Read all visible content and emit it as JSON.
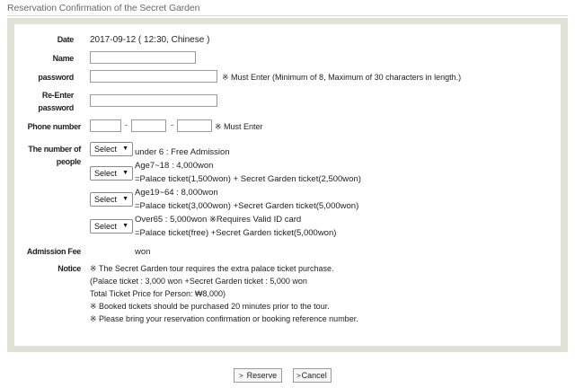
{
  "title": "Reservation Confirmation of the Secret Garden",
  "form": {
    "date_label": "Date",
    "date_value": "2017-09-12 ( 12:30, Chinese )",
    "name_label": "Name",
    "password_label": "password",
    "must_enter_password": "※ Must Enter (Minimum of 8, Maximum of 30 characters in length.)",
    "reenter_label_line1": "Re-Enter",
    "reenter_label_line2": "password",
    "phone_label": "Phone number",
    "phone_dash": "-",
    "must_enter_phone": "※ Must Enter",
    "people_label_line1": "The number of",
    "people_label_line2": "people",
    "select_placeholder": "Select",
    "select_arrow": "▼",
    "tiers": [
      {
        "line1": "under 6 : Free Admission",
        "line2": ""
      },
      {
        "line1": "Age7~18 : 4,000won",
        "line2": "=Palace ticket(1,500won) + Secret Garden ticket(2,500won)"
      },
      {
        "line1": "Age19~64 : 8,000won",
        "line2": "=Palace ticket(3,000won) +Secret Garden ticket(5,000won)"
      },
      {
        "line1": "Over65 : 5,000won ※Requires Valid ID card",
        "line2": "=Palace ticket(free) +Secret Garden ticket(5,000won)"
      }
    ],
    "fee_label": "Admission Fee",
    "fee_unit": "won",
    "notice_label": "Notice",
    "notice_lines": [
      "※ The Secret Garden tour requires the extra palace ticket purchase.",
      "(Palace ticket : 3,000 won +Secret Garden ticket : 5,000 won",
      "Total Ticket Price for Person: ₩8,000)",
      "※ Booked tickets should be purchased 20 minutes prior to the tour.",
      "※ Please bring your reservation confirmation or booking reference number."
    ]
  },
  "buttons": {
    "chevron": ">",
    "reserve": "Reserve",
    "cancel": "Cancel"
  }
}
